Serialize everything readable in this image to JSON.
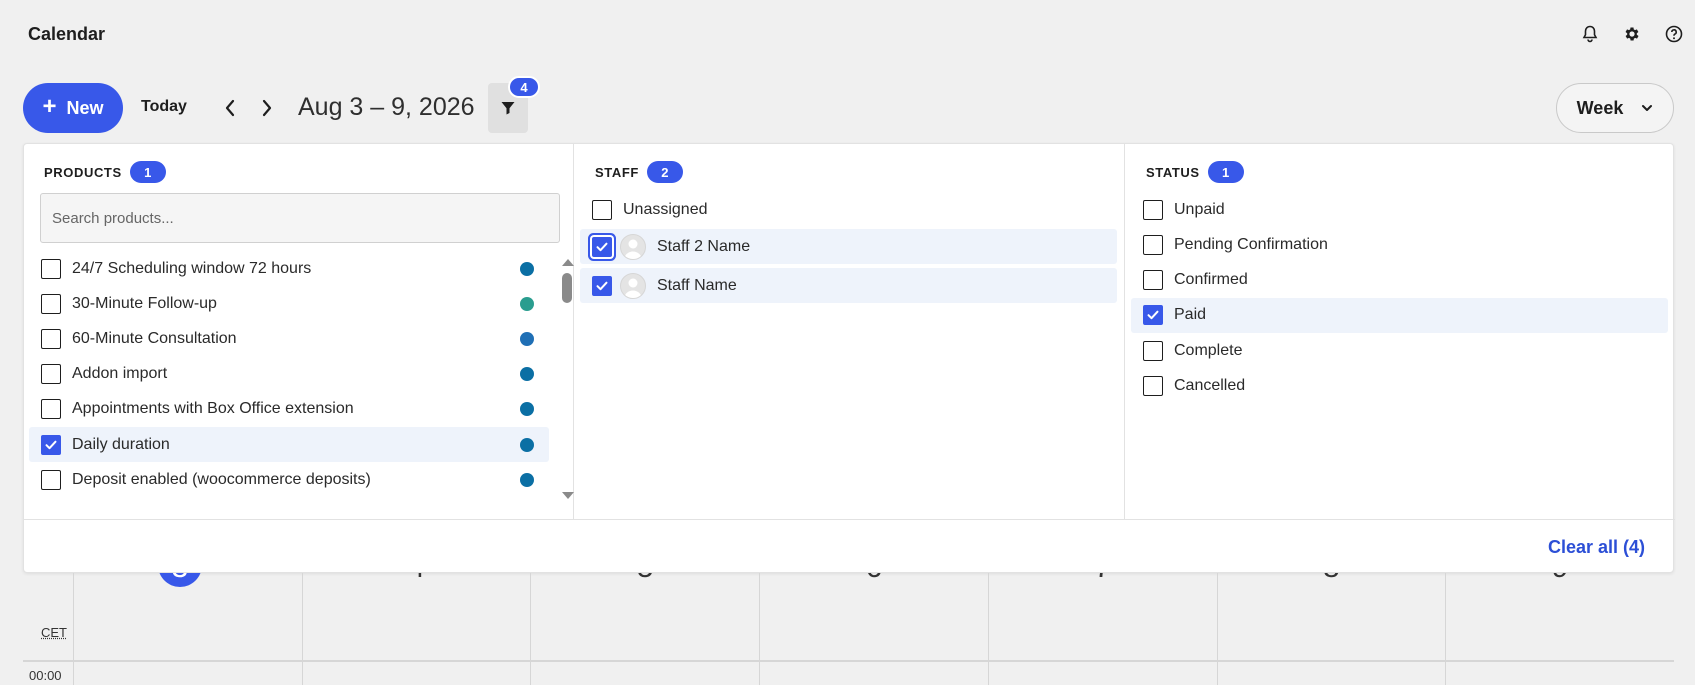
{
  "app": {
    "title": "Calendar"
  },
  "header_icons": [
    {
      "name": "bell-icon"
    },
    {
      "name": "gear-icon"
    },
    {
      "name": "help-icon"
    }
  ],
  "toolbar": {
    "new_label": "New",
    "today_label": "Today",
    "date_range": "Aug 3 – 9, 2026",
    "filter_count": "4",
    "view_label": "Week"
  },
  "filters": {
    "products": {
      "heading": "PRODUCTS",
      "count": "1",
      "search_placeholder": "Search products...",
      "items": [
        {
          "label": "24/7 Scheduling window 72 hours",
          "checked": false,
          "color": "#0b6fa4"
        },
        {
          "label": "30-Minute Follow-up",
          "checked": false,
          "color": "#2a9d8f"
        },
        {
          "label": "60-Minute Consultation",
          "checked": false,
          "color": "#1f6fb5"
        },
        {
          "label": "Addon import",
          "checked": false,
          "color": "#0b6fa4"
        },
        {
          "label": "Appointments with Box Office extension",
          "checked": false,
          "color": "#0b6fa4"
        },
        {
          "label": "Daily duration",
          "checked": true,
          "color": "#0b6fa4"
        },
        {
          "label": "Deposit enabled (woocommerce deposits)",
          "checked": false,
          "color": "#0b6fa4"
        }
      ]
    },
    "staff": {
      "heading": "STAFF",
      "count": "2",
      "items": [
        {
          "label": "Unassigned",
          "checked": false,
          "avatar": false
        },
        {
          "label": "Staff 2 Name",
          "checked": true,
          "avatar": true
        },
        {
          "label": "Staff Name",
          "checked": true,
          "avatar": true
        }
      ]
    },
    "status": {
      "heading": "STATUS",
      "count": "1",
      "items": [
        {
          "label": "Unpaid",
          "checked": false
        },
        {
          "label": "Pending Confirmation",
          "checked": false
        },
        {
          "label": "Confirmed",
          "checked": false
        },
        {
          "label": "Paid",
          "checked": true
        },
        {
          "label": "Complete",
          "checked": false
        },
        {
          "label": "Cancelled",
          "checked": false
        }
      ]
    },
    "clear_all_label": "Clear all (4)"
  },
  "calendar": {
    "timezone": "CET",
    "first_time": "00:00",
    "days": [
      "3",
      "4",
      "5",
      "6",
      "7",
      "8",
      "9"
    ],
    "today_index": 0
  }
}
